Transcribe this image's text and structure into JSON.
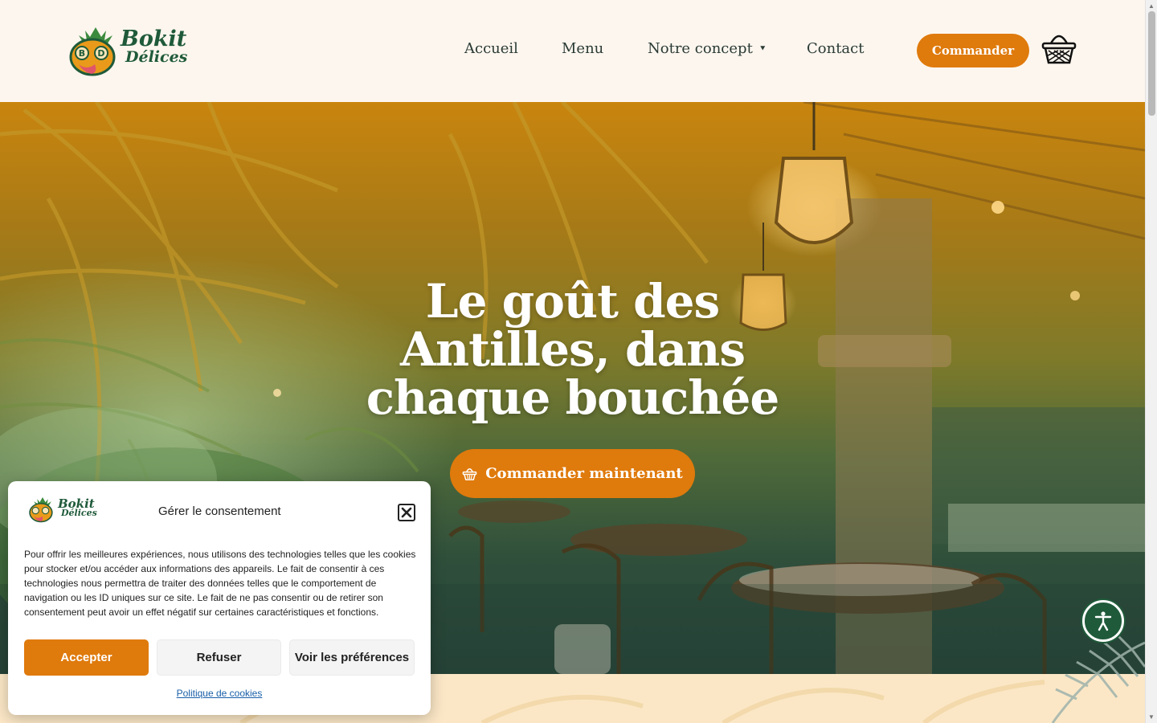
{
  "header": {
    "logo": {
      "line1": "Bokit",
      "line2": "Délices",
      "initials_left": "B",
      "initials_right": "D"
    },
    "nav": [
      {
        "label": "Accueil"
      },
      {
        "label": "Menu"
      },
      {
        "label": "Notre concept"
      },
      {
        "label": "Contact"
      }
    ],
    "order_label": "Commander"
  },
  "hero": {
    "title": "Le goût des Antilles, dans chaque bouchée",
    "cta_label": "Commander maintenant"
  },
  "cookie": {
    "title": "Gérer le consentement",
    "body": "Pour offrir les meilleures expériences, nous utilisons des technologies telles que les cookies pour stocker et/ou accéder aux informations des appareils. Le fait de consentir à ces technologies nous permettra de traiter des données telles que le comportement de navigation ou les ID uniques sur ce site. Le fait de ne pas consentir ou de retirer son consentement peut avoir un effet négatif sur certaines caractéristiques et fonctions.",
    "accept_label": "Accepter",
    "refuse_label": "Refuser",
    "prefs_label": "Voir les préférences",
    "policy_label": "Politique de cookies"
  },
  "icons": {
    "cart": "basket-icon",
    "close": "close-icon",
    "accessibility": "accessibility-icon",
    "dropdown": "chevron-down-icon"
  },
  "colors": {
    "accent": "#df7a0c",
    "brand_green": "#1f5a3a",
    "background": "#fdf6ee"
  }
}
